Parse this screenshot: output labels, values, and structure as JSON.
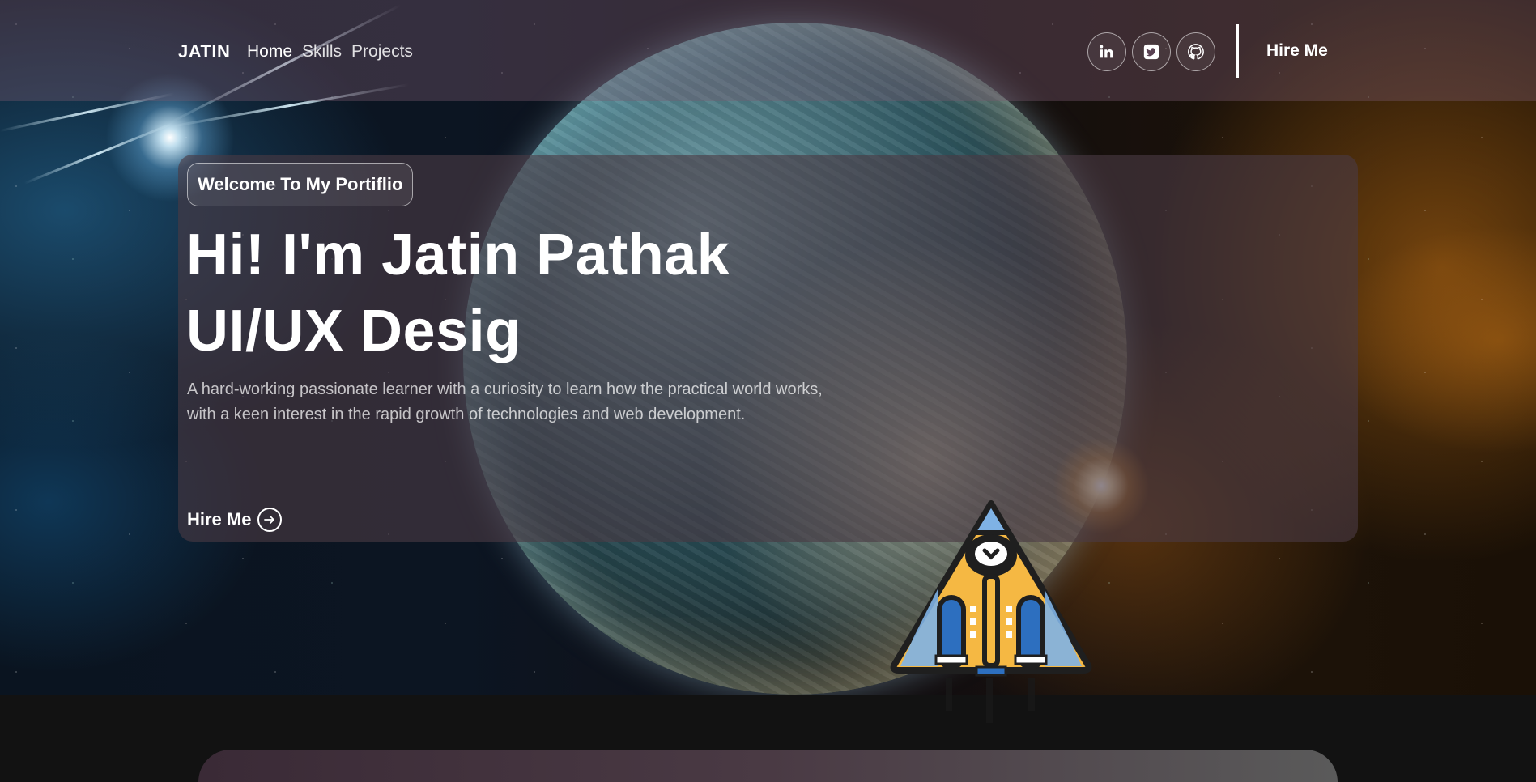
{
  "header": {
    "brand": "JATIN",
    "nav": [
      {
        "label": "Home",
        "active": true
      },
      {
        "label": "Skills",
        "active": false
      },
      {
        "label": "Projects",
        "active": false
      }
    ],
    "socials": [
      {
        "icon": "linkedin-icon"
      },
      {
        "icon": "twitter-icon"
      },
      {
        "icon": "github-icon"
      }
    ],
    "hire_label": "Hire Me"
  },
  "hero": {
    "badge": "Welcome To My Portiflio",
    "title_line1": "Hi! I'm Jatin Pathak",
    "title_line2": "UI/UX Desig",
    "description": "A hard-working passionate learner with a curiosity to learn how the practical world works, with a keen interest in the rapid growth of technologies and web development.",
    "cta_label": "Hire Me",
    "cta_icon": "arrow-right-circle-icon"
  },
  "colors": {
    "background": "#121212",
    "header_bg": "rgba(120,90,110,0.38)",
    "card_bg": "rgba(75,58,68,0.62)",
    "text": "#ffffff"
  }
}
